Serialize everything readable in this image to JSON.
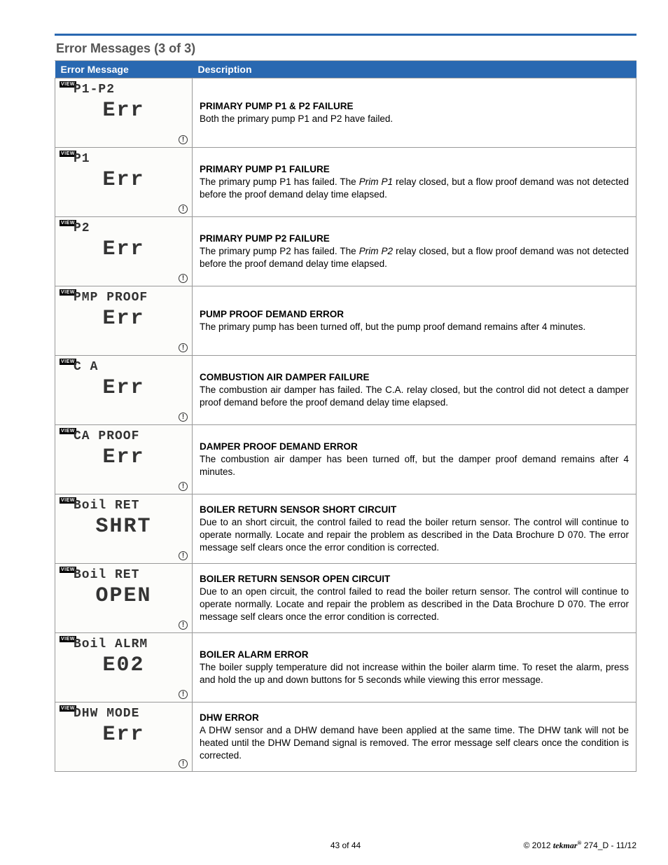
{
  "section_title": "Error Messages (3 of 3)",
  "headers": {
    "col1": "Error Message",
    "col2": "Description"
  },
  "view_label": "VIEW",
  "warn_glyph": "!",
  "rows": [
    {
      "line1": "P1-P2",
      "line2": "Err",
      "title": "PRIMARY PUMP P1 & P2 FAILURE",
      "body": "Both the primary pump P1 and P2 have failed."
    },
    {
      "line1": "P1",
      "line2": "Err",
      "title": "PRIMARY PUMP P1 FAILURE",
      "body": "The primary pump P1 has failed. The <em>Prim P1</em> relay closed, but a flow proof demand was not detected before the proof demand delay time elapsed."
    },
    {
      "line1": "P2",
      "line2": "Err",
      "title": "PRIMARY PUMP P2 FAILURE",
      "body": "The primary pump P2 has failed. The <em>Prim P2</em> relay closed, but a flow proof demand was not detected before the proof demand delay time elapsed."
    },
    {
      "line1": "PMP PROOF",
      "line2": "Err",
      "title": "PUMP PROOF DEMAND ERROR",
      "body": "The primary pump has been turned off, but the pump proof demand remains after 4 minutes."
    },
    {
      "line1": "C A",
      "line2": "Err",
      "title": "COMBUSTION AIR DAMPER FAILURE",
      "body": "The combustion air damper has failed. The C.A. relay closed, but the control did not detect a damper proof demand before the proof demand delay time elapsed."
    },
    {
      "line1": "CA PROOF",
      "line2": "Err",
      "title": "DAMPER PROOF DEMAND ERROR",
      "body": "The combustion air damper has been turned off, but the damper proof demand remains after 4 minutes."
    },
    {
      "line1": "Boil RET",
      "line2": "SHRT",
      "title": "BOILER RETURN SENSOR SHORT CIRCUIT",
      "body": "Due to an short circuit, the control failed to read the boiler return sensor. The control will continue to operate normally. Locate and repair the problem as described in the Data Brochure D 070. The error message self clears once the error condition is corrected."
    },
    {
      "line1": "Boil RET",
      "line2": "OPEN",
      "title": "BOILER RETURN SENSOR OPEN CIRCUIT",
      "body": "Due to an open circuit, the control failed to read the boiler return sensor. The control will continue to operate normally. Locate and repair the problem as described in the Data Brochure D 070. The error message self clears once the error condition is corrected."
    },
    {
      "line1": "Boil ALRM",
      "line2": "E02",
      "title": "BOILER ALARM ERROR",
      "body": "The boiler supply temperature did not increase within the boiler alarm time. To reset the alarm, press and hold the up and down buttons for 5 seconds while viewing this error message."
    },
    {
      "line1": "DHW MODE",
      "line2": "Err",
      "title": "DHW ERROR",
      "body": "A DHW sensor and a DHW demand have been applied at the same time. The DHW tank will not be heated until the DHW Demand signal is removed. The error message self clears once the condition is corrected."
    }
  ],
  "footer": {
    "page": "43 of 44",
    "copyright": "© 2012",
    "brand": "tekmar",
    "doc": " 274_D - 11/12"
  }
}
